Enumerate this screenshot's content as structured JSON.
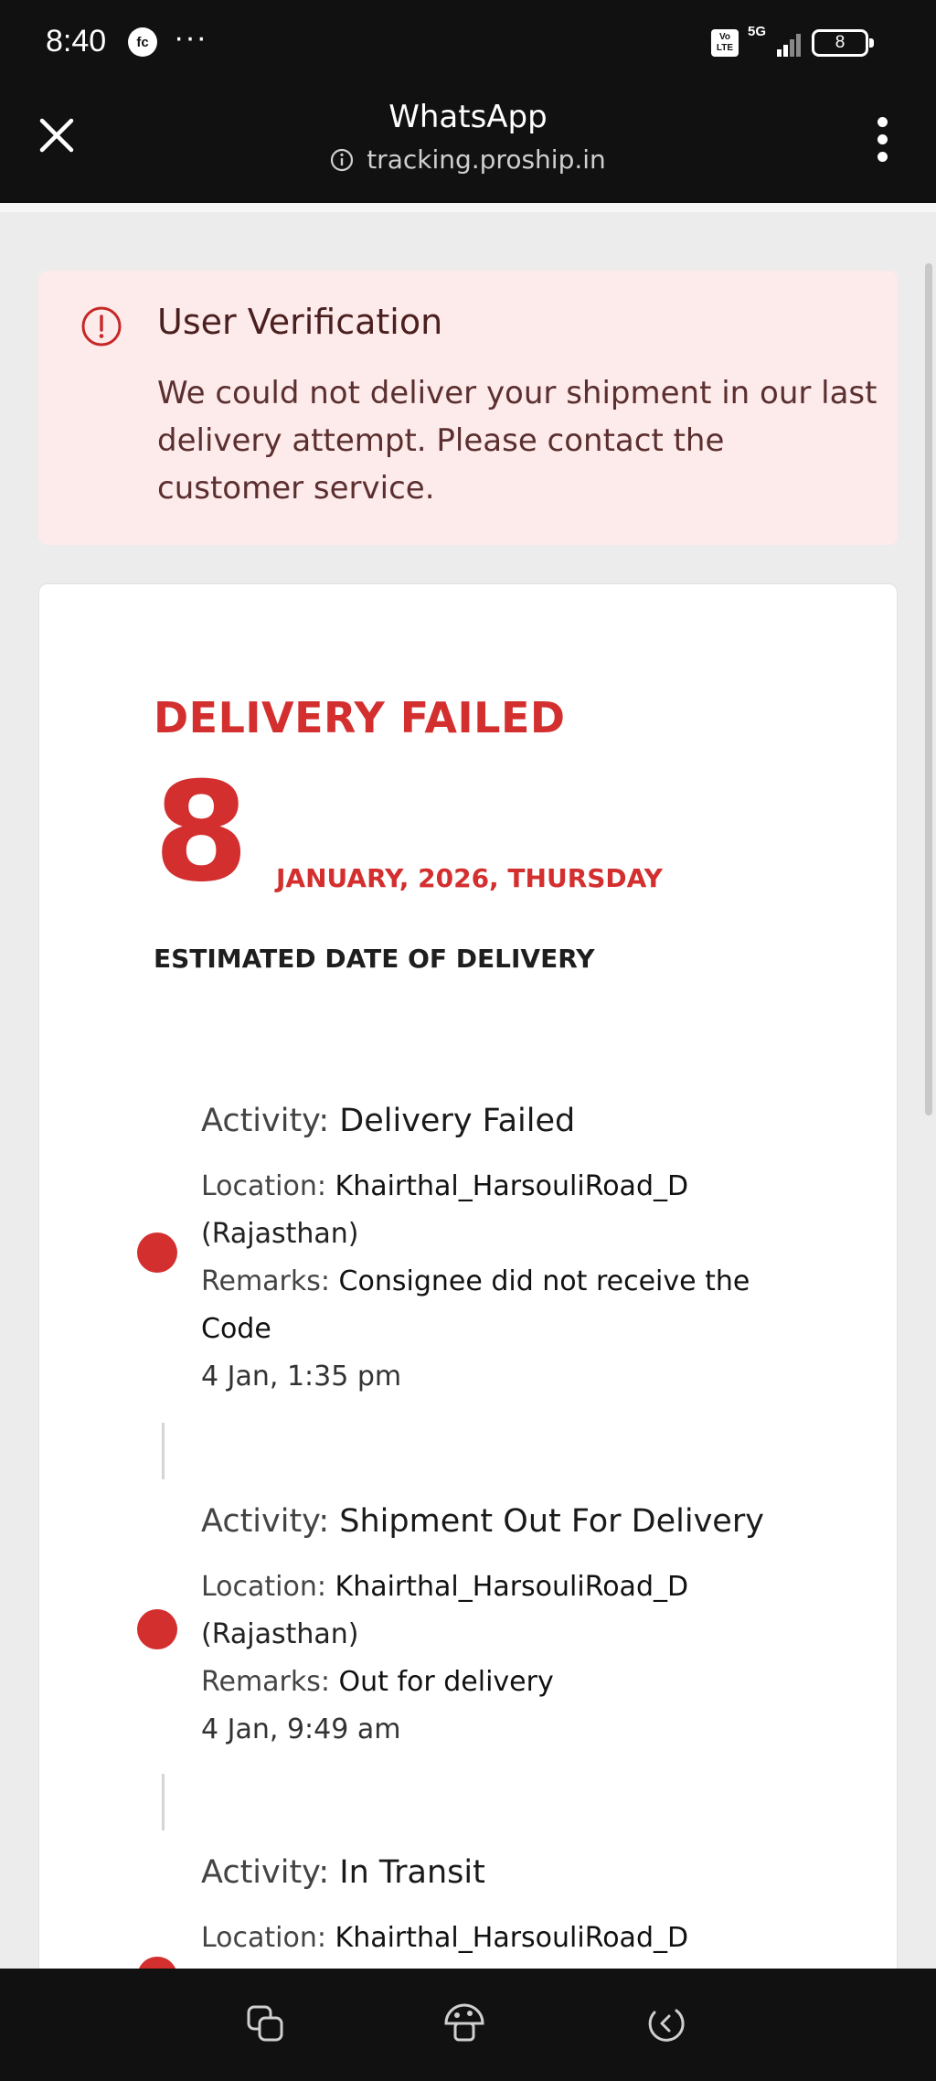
{
  "status_bar": {
    "time": "8:40",
    "app_icon_text": "fc",
    "more": "···",
    "volte": "Vo LTE",
    "network": "5G",
    "battery": "8"
  },
  "browser": {
    "title": "WhatsApp",
    "url": "tracking.proship.in"
  },
  "alert": {
    "title": "User Verification",
    "message": "We could not deliver your shipment in our last delivery attempt. Please contact the customer service."
  },
  "delivery": {
    "status": "DELIVERY FAILED",
    "day": "8",
    "date": "JANUARY, 2026, THURSDAY",
    "estimated_label": "ESTIMATED DATE OF DELIVERY"
  },
  "activities": [
    {
      "activity_label": "Activity: ",
      "activity": "Delivery Failed",
      "location_label": "Location: ",
      "location": "Khairthal_HarsouliRoad_D",
      "region": "(Rajasthan)",
      "remarks_label": "Remarks: ",
      "remarks_1": "Consignee did not receive the",
      "remarks_2": "Code",
      "time": "4 Jan, 1:35 pm"
    },
    {
      "activity_label": "Activity: ",
      "activity": "Shipment Out For Delivery",
      "location_label": "Location: ",
      "location": "Khairthal_HarsouliRoad_D",
      "region": "(Rajasthan)",
      "remarks_label": "Remarks: ",
      "remarks_1": "Out for delivery",
      "time": "4 Jan, 9:49 am"
    },
    {
      "activity_label": "Activity: ",
      "activity": "In Transit",
      "location_label": "Location: ",
      "location": "Khairthal_HarsouliRoad_D"
    }
  ],
  "colors": {
    "accent_red": "#d32f2f",
    "alert_bg": "#fdeaea",
    "bar_bg": "#111111"
  },
  "icons": [
    "close-icon",
    "info-icon",
    "more-vert-icon",
    "alert-circle-icon",
    "recent-apps-icon",
    "home-icon",
    "back-icon"
  ]
}
